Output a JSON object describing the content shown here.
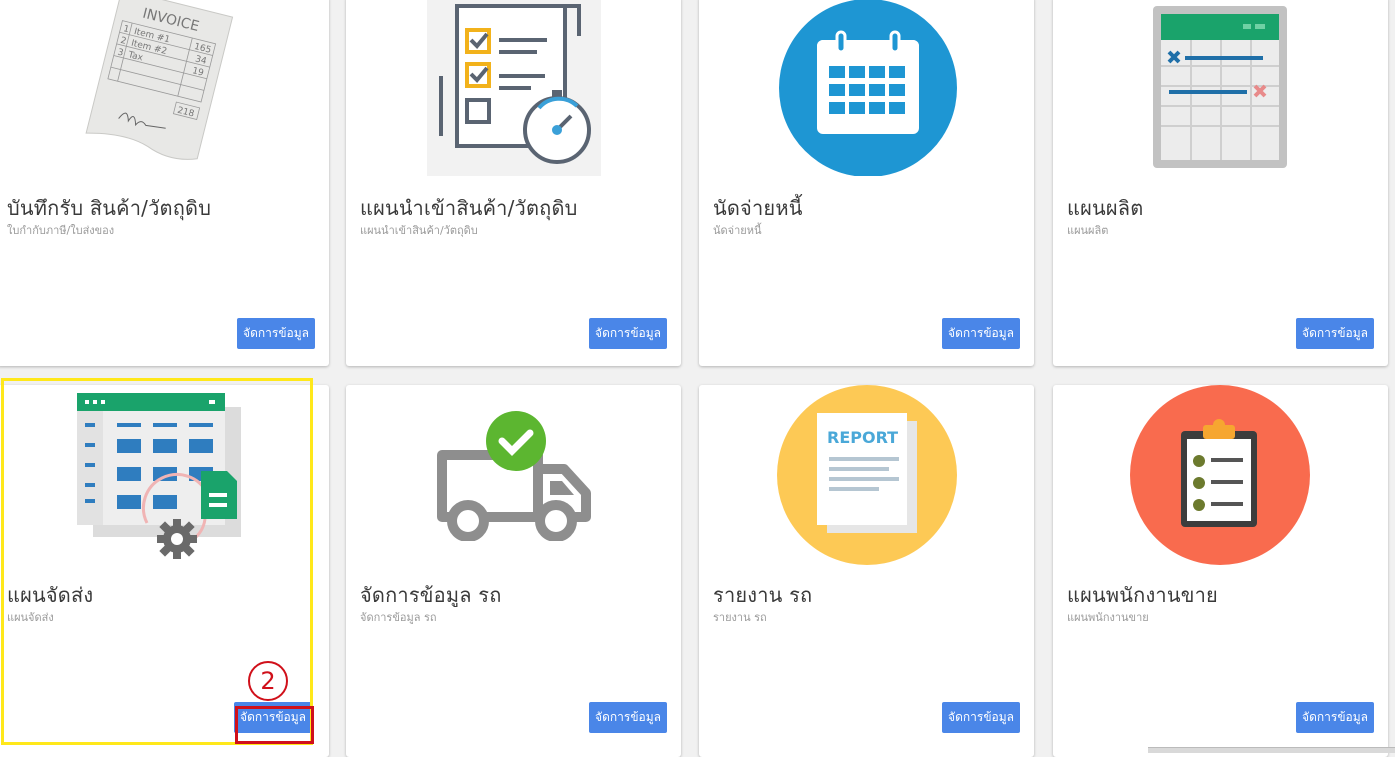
{
  "cards": [
    {
      "title": "บันทึกรับ สินค้า/วัตถุดิบ",
      "subtitle": "ใบกำกับภาษี/ใบส่งของ",
      "button": "จัดการข้อมูล",
      "icon": "invoice-icon",
      "invoice": {
        "heading": "INVOICE",
        "rows": [
          {
            "n": "1",
            "item": "Item #1",
            "amt": "165"
          },
          {
            "n": "2",
            "item": "Item #2",
            "amt": "34"
          },
          {
            "n": "3",
            "item": "Tax",
            "amt": "19"
          }
        ],
        "total": "218"
      }
    },
    {
      "title": "แผนนำเข้าสินค้า/วัตถุดิบ",
      "subtitle": "แผนนำเข้าสินค้า/วัตถุดิบ",
      "button": "จัดการข้อมูล",
      "icon": "checklist-stopwatch-icon"
    },
    {
      "title": "นัดจ่ายหนี้",
      "subtitle": "นัดจ่ายหนี้",
      "button": "จัดการข้อมูล",
      "icon": "calendar-icon"
    },
    {
      "title": "แผนผลิต",
      "subtitle": "แผนผลิต",
      "button": "จัดการข้อมูล",
      "icon": "spreadsheet-icon"
    },
    {
      "title": "แผนจัดส่ง",
      "subtitle": "แผนจัดส่ง",
      "button": "จัดการข้อมูล",
      "icon": "spreadsheet-gear-icon"
    },
    {
      "title": "จัดการข้อมูล รถ",
      "subtitle": "จัดการข้อมูล รถ",
      "button": "จัดการข้อมูล",
      "icon": "truck-check-icon"
    },
    {
      "title": "รายงาน รถ",
      "subtitle": "รายงาน รถ",
      "button": "จัดการข้อมูล",
      "icon": "report-icon",
      "report_label": "REPORT"
    },
    {
      "title": "แผนพนักงานขาย",
      "subtitle": "แผนพนักงานขาย",
      "button": "จัดการข้อมูล",
      "icon": "clipboard-checklist-icon"
    }
  ],
  "annotation": {
    "step": "2"
  },
  "colors": {
    "button": "#4a86e8",
    "highlight_yellow": "#ffe81a",
    "highlight_red": "#d0101a"
  }
}
